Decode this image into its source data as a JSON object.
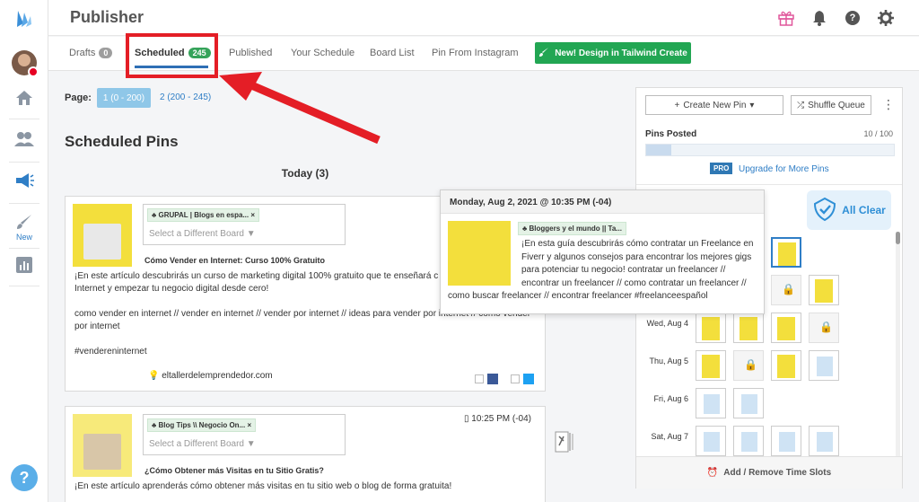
{
  "header": {
    "title": "Publisher"
  },
  "tabs": {
    "drafts": {
      "label": "Drafts",
      "count": "0"
    },
    "scheduled": {
      "label": "Scheduled",
      "count": "245"
    },
    "published": "Published",
    "your_schedule": "Your Schedule",
    "board_list": "Board List",
    "pin_from_instagram": "Pin From Instagram",
    "design_button": "New! Design in Tailwind Create"
  },
  "sidebar": {
    "new_label": "New"
  },
  "pagination": {
    "label": "Page:",
    "page1": "1 (0 - 200)",
    "page2": "2 (200 - 245)"
  },
  "main": {
    "title": "Scheduled Pins",
    "today": "Today (3)"
  },
  "pins": [
    {
      "board": "GRUPAL | Blogs en espa...",
      "board_select": "Select a Different Board",
      "title": "Cómo Vender en Internet: Curso 100% Gratuito",
      "desc1": "¡En este artículo descubrirás un curso de marketing digital 100% gratuito que te enseñará c",
      "desc2": "Internet y empezar tu negocio digital desde cero!",
      "desc3": "como vender en internet // vender en internet // vender por internet // ideas para vender por internet // como vender por internet",
      "desc4": "#vendereninternet",
      "link": "eltallerdelemprendedor.com"
    },
    {
      "board": "Blog Tips \\\\ Negocio On...",
      "board_select": "Select a Different Board",
      "time": "10:25 PM (-04)",
      "title": "¿Cómo Obtener más Visitas en tu Sitio Gratis?",
      "desc1": "¡En este artículo aprenderás cómo obtener más visitas en tu sitio web o blog de forma gratuita!"
    }
  ],
  "tooltip": {
    "date": "Monday, Aug 2, 2021 @ 10:35 PM (-04)",
    "board": "Bloggers y el mundo || Ta...",
    "desc": "¡En esta guía descubrirás cómo contratar un Freelance en Fiverr y algunos consejos para encontrar los mejores gigs para potenciar tu negocio! contratar un freelancer // encontrar un freelancer // como contratar un freelancer // como buscar freelancer // encontrar freelancer #freelanceespañol"
  },
  "queue": {
    "create_pin": "Create New Pin",
    "shuffle": "Shuffle Queue",
    "pins_posted_label": "Pins Posted",
    "pins_posted_count": "10 / 100",
    "pins_posted_fraction": 0.1,
    "pro_badge": "PRO",
    "upgrade": "Upgrade for More Pins",
    "all_clear": "All Clear",
    "days": [
      "Wed, Aug 4",
      "Thu, Aug 5",
      "Fri, Aug 6",
      "Sat, Aug 7"
    ],
    "time_slots": "Add / Remove Time Slots"
  },
  "colors": {
    "brand_green": "#22a653",
    "accent_blue": "#2f7ec6",
    "highlight_red": "#e41e26"
  }
}
